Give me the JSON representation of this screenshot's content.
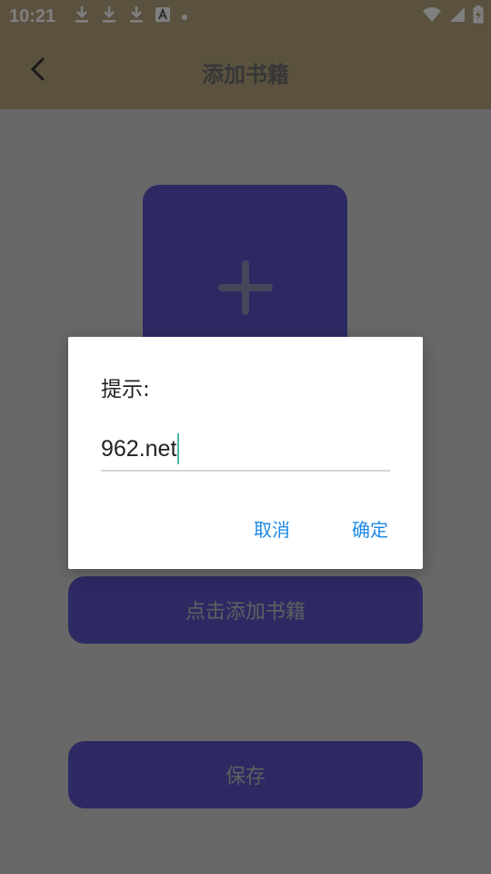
{
  "status_bar": {
    "time": "10:21",
    "left_icons": [
      "download-icon",
      "download-icon",
      "download-icon",
      "font-a-icon",
      "dot-icon"
    ],
    "right_icons": [
      "wifi-icon",
      "signal-icon",
      "battery-charging-icon"
    ]
  },
  "app_bar": {
    "title": "添加书籍",
    "back_icon": "chevron-left-icon"
  },
  "main": {
    "cover_icon": "plus-icon",
    "add_book_label": "点击添加书籍",
    "save_label": "保存"
  },
  "dialog": {
    "title": "提示:",
    "input_value": "962.net",
    "cancel_label": "取消",
    "confirm_label": "确定"
  },
  "colors": {
    "header": "#b5a57f",
    "primary_button": "#5b55c6",
    "dialog_action": "#1e88e5",
    "cursor": "#4db6ac"
  }
}
